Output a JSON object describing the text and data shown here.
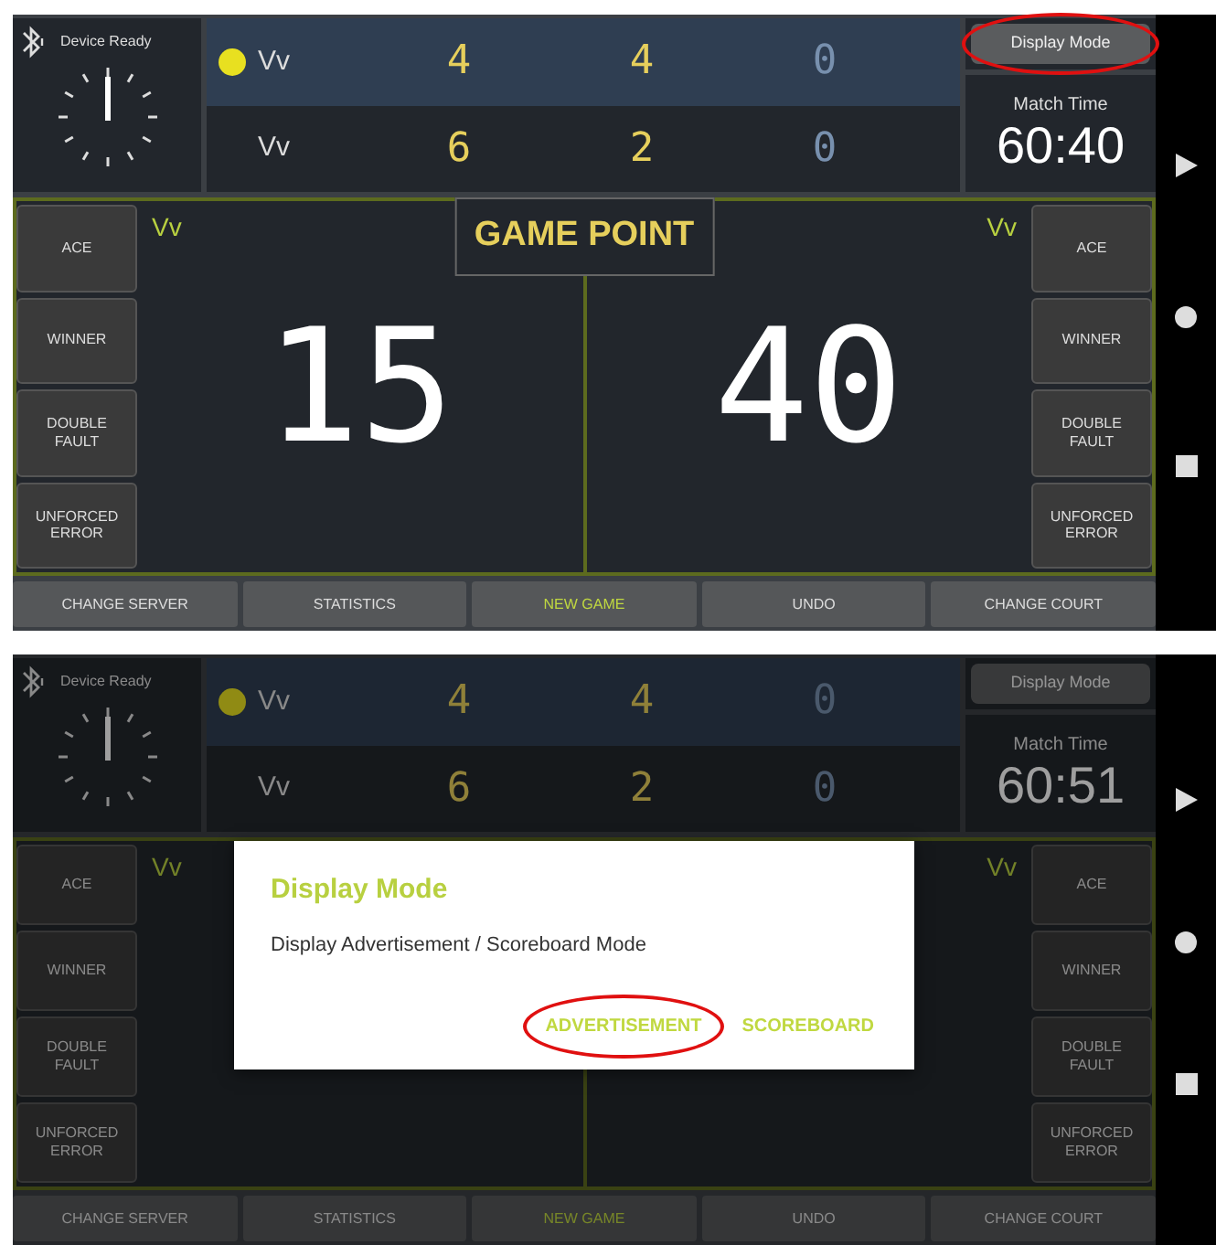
{
  "screens": [
    {
      "dimmed": false,
      "status": {
        "text": "Device Ready"
      },
      "players": [
        {
          "name": "Vv",
          "serving": true,
          "scores": [
            {
              "value": "4",
              "dim": false
            },
            {
              "value": "4",
              "dim": false
            },
            {
              "value": "0",
              "dim": true
            }
          ]
        },
        {
          "name": "Vv",
          "serving": false,
          "scores": [
            {
              "value": "6",
              "dim": false
            },
            {
              "value": "2",
              "dim": false
            },
            {
              "value": "0",
              "dim": true
            }
          ]
        }
      ],
      "display_mode_button": {
        "label": "Display Mode",
        "circled": true
      },
      "match_time": {
        "label": "Match Time",
        "value": "60:40"
      },
      "banner": "GAME POINT",
      "sides": [
        {
          "name": "Vv",
          "score": "15"
        },
        {
          "name": "Vv",
          "score": "40"
        }
      ],
      "left_buttons": [
        "ACE",
        "WINNER",
        "DOUBLE FAULT",
        "UNFORCED ERROR"
      ],
      "right_buttons": [
        "ACE",
        "WINNER",
        "DOUBLE FAULT",
        "UNFORCED ERROR"
      ],
      "bottom_buttons": [
        {
          "label": "CHANGE SERVER",
          "accent": false
        },
        {
          "label": "STATISTICS",
          "accent": false
        },
        {
          "label": "NEW GAME",
          "accent": true
        },
        {
          "label": "UNDO",
          "accent": false
        },
        {
          "label": "CHANGE COURT",
          "accent": false
        }
      ]
    },
    {
      "dimmed": true,
      "status": {
        "text": "Device Ready"
      },
      "players": [
        {
          "name": "Vv",
          "serving": true,
          "scores": [
            {
              "value": "4",
              "dim": false
            },
            {
              "value": "4",
              "dim": false
            },
            {
              "value": "0",
              "dim": true
            }
          ]
        },
        {
          "name": "Vv",
          "serving": false,
          "scores": [
            {
              "value": "6",
              "dim": false
            },
            {
              "value": "2",
              "dim": false
            },
            {
              "value": "0",
              "dim": true
            }
          ]
        }
      ],
      "display_mode_button": {
        "label": "Display Mode",
        "circled": false
      },
      "match_time": {
        "label": "Match Time",
        "value": "60:51"
      },
      "sides": [
        {
          "name": "Vv"
        },
        {
          "name": "Vv"
        }
      ],
      "left_buttons": [
        "ACE",
        "WINNER",
        "DOUBLE FAULT",
        "UNFORCED ERROR"
      ],
      "right_buttons": [
        "ACE",
        "WINNER",
        "DOUBLE FAULT",
        "UNFORCED ERROR"
      ],
      "bottom_buttons": [
        {
          "label": "CHANGE SERVER",
          "accent": false
        },
        {
          "label": "STATISTICS",
          "accent": false
        },
        {
          "label": "NEW GAME",
          "accent": true
        },
        {
          "label": "UNDO",
          "accent": false
        },
        {
          "label": "CHANGE COURT",
          "accent": false
        }
      ],
      "dialog": {
        "title": "Display Mode",
        "message": "Display Advertisement / Scoreboard Mode",
        "buttons": [
          {
            "label": "ADVERTISEMENT",
            "circled": true
          },
          {
            "label": "SCOREBOARD",
            "circled": false
          }
        ]
      }
    }
  ]
}
